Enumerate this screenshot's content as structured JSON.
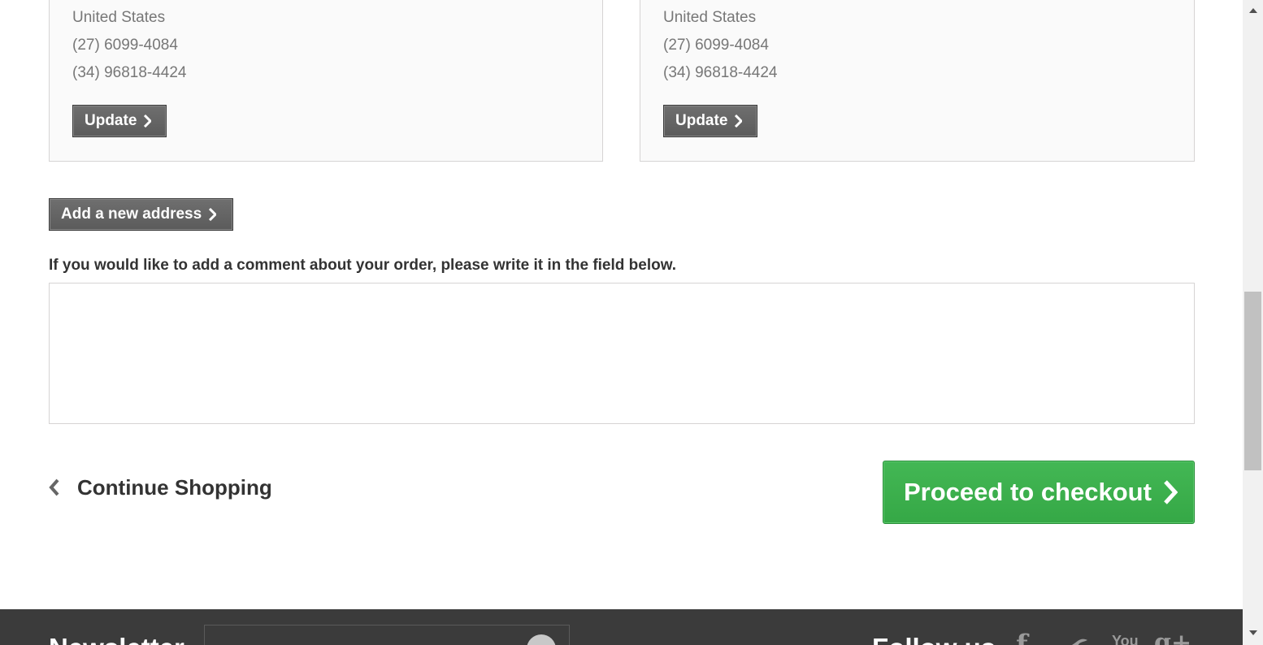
{
  "addresses": [
    {
      "country": "United States",
      "phone": "(27) 6099-4084",
      "mobile": "(34) 96818-4424",
      "update_label": "Update"
    },
    {
      "country": "United States",
      "phone": "(27) 6099-4084",
      "mobile": "(34) 96818-4424",
      "update_label": "Update"
    }
  ],
  "add_address_label": "Add a new address",
  "comment": {
    "label": "If you would like to add a comment about your order, please write it in the field below.",
    "value": ""
  },
  "actions": {
    "continue_label": "Continue Shopping",
    "checkout_label": "Proceed to checkout"
  },
  "footer": {
    "newsletter_title": "Newsletter",
    "follow_title": "Follow us",
    "social": {
      "facebook_glyph": "f",
      "youtube_glyph": "You",
      "googleplus_glyph": "g+"
    }
  },
  "colors": {
    "checkout_green": "#3aae4b",
    "dark_button": "#636363",
    "footer_bg": "#3b3b3b"
  }
}
